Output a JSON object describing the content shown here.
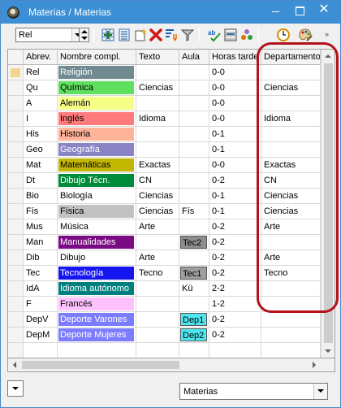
{
  "window": {
    "title": "Materias / Materias"
  },
  "toolbar": {
    "selector_value": "Rel",
    "tools": [
      "new-record-icon",
      "list-view-icon",
      "new-item-icon",
      "delete-icon",
      "sort-icon",
      "filter-icon",
      "spell-check-icon",
      "grid-settings-icon",
      "properties-icon",
      "clock-icon",
      "palette-icon"
    ]
  },
  "table": {
    "columns": [
      "Abrev.",
      "Nombre compl.",
      "Texto",
      "Aula",
      "Horas tarde",
      "Departamento"
    ],
    "rows": [
      {
        "abrev": "Rel",
        "nombre": "Religión",
        "color": "#6f8a91",
        "text_color": "#ffffff",
        "texto": "",
        "aula": "",
        "aula_color": "",
        "horas": "0-0",
        "depto": ""
      },
      {
        "abrev": "Qu",
        "nombre": "Química",
        "color": "#5ee05e",
        "text_color": "#000000",
        "texto": "Ciencias",
        "aula": "",
        "aula_color": "",
        "horas": "0-0",
        "depto": "Ciencias"
      },
      {
        "abrev": "A",
        "nombre": "Alemán",
        "color": "#f5ff85",
        "text_color": "#000000",
        "texto": "",
        "aula": "",
        "aula_color": "",
        "horas": "0-0",
        "depto": ""
      },
      {
        "abrev": "I",
        "nombre": "Inglés",
        "color": "#ff7b7b",
        "text_color": "#000000",
        "texto": "Idioma",
        "aula": "",
        "aula_color": "",
        "horas": "0-0",
        "depto": "Idioma"
      },
      {
        "abrev": "His",
        "nombre": "Historia",
        "color": "#ffb49a",
        "text_color": "#000000",
        "texto": "",
        "aula": "",
        "aula_color": "",
        "horas": "0-1",
        "depto": ""
      },
      {
        "abrev": "Geo",
        "nombre": "Geografía",
        "color": "#8a83c4",
        "text_color": "#ffffff",
        "texto": "",
        "aula": "",
        "aula_color": "",
        "horas": "0-1",
        "depto": ""
      },
      {
        "abrev": "Mat",
        "nombre": "Matemáticas",
        "color": "#c2b700",
        "text_color": "#000000",
        "texto": "Exactas",
        "aula": "",
        "aula_color": "",
        "horas": "0-0",
        "depto": "Exactas"
      },
      {
        "abrev": "Dt",
        "nombre": "Dibujo Técn.",
        "color": "#008b3a",
        "text_color": "#ffffff",
        "texto": "CN",
        "aula": "",
        "aula_color": "",
        "horas": "0-2",
        "depto": "CN"
      },
      {
        "abrev": "Bio",
        "nombre": "Biología",
        "color": "#ffffff",
        "text_color": "#000000",
        "texto": "Ciencias",
        "aula": "",
        "aula_color": "",
        "horas": "0-1",
        "depto": "Ciencias"
      },
      {
        "abrev": "Fís",
        "nombre": "Física",
        "color": "#c2c2c2",
        "text_color": "#000000",
        "texto": "Ciencias",
        "aula": "Fís",
        "aula_color": "",
        "horas": "0-1",
        "depto": "Ciencias"
      },
      {
        "abrev": "Mus",
        "nombre": "Música",
        "color": "#ffffff",
        "text_color": "#000000",
        "texto": "Arte",
        "aula": "",
        "aula_color": "",
        "horas": "0-2",
        "depto": "Arte"
      },
      {
        "abrev": "Man",
        "nombre": "Manualidades",
        "color": "#7a0a84",
        "text_color": "#ffffff",
        "texto": "",
        "aula": "Tec2",
        "aula_color": "#8d8d8d",
        "horas": "0-2",
        "depto": ""
      },
      {
        "abrev": "Dib",
        "nombre": "Dibujo",
        "color": "#ffffff",
        "text_color": "#000000",
        "texto": "Arte",
        "aula": "",
        "aula_color": "",
        "horas": "0-2",
        "depto": "Arte"
      },
      {
        "abrev": "Tec",
        "nombre": "Tecnología",
        "color": "#1515f0",
        "text_color": "#ffffff",
        "texto": "Tecno",
        "aula": "Tec1",
        "aula_color": "#9e9e9e",
        "horas": "0-2",
        "depto": "Tecno"
      },
      {
        "abrev": "IdA",
        "nombre": "Idioma autónomo",
        "color": "#007f7f",
        "text_color": "#ffffff",
        "texto": "",
        "aula": "Kü",
        "aula_color": "",
        "horas": "2-2",
        "depto": ""
      },
      {
        "abrev": "F",
        "nombre": "Francés",
        "color": "#ffc2ff",
        "text_color": "#000000",
        "texto": "",
        "aula": "",
        "aula_color": "",
        "horas": "1-2",
        "depto": ""
      },
      {
        "abrev": "DepV",
        "nombre": "Deporte Varones",
        "color": "#7c7cff",
        "text_color": "#ffffff",
        "texto": "",
        "aula": "Dep1",
        "aula_color": "#4ee7f0",
        "horas": "0-2",
        "depto": ""
      },
      {
        "abrev": "DepM",
        "nombre": "Deporte Mujeres",
        "color": "#7c7cff",
        "text_color": "#ffffff",
        "texto": "",
        "aula": "Dep2",
        "aula_color": "#4ee7f0",
        "horas": "0-2",
        "depto": ""
      }
    ],
    "empty_rows": 1
  },
  "footer": {
    "view_selector_value": "Materias"
  },
  "colors": {
    "titlebar": "#3c8fd4",
    "highlight": "#b3121c",
    "current_marker": "#f6d48d"
  }
}
